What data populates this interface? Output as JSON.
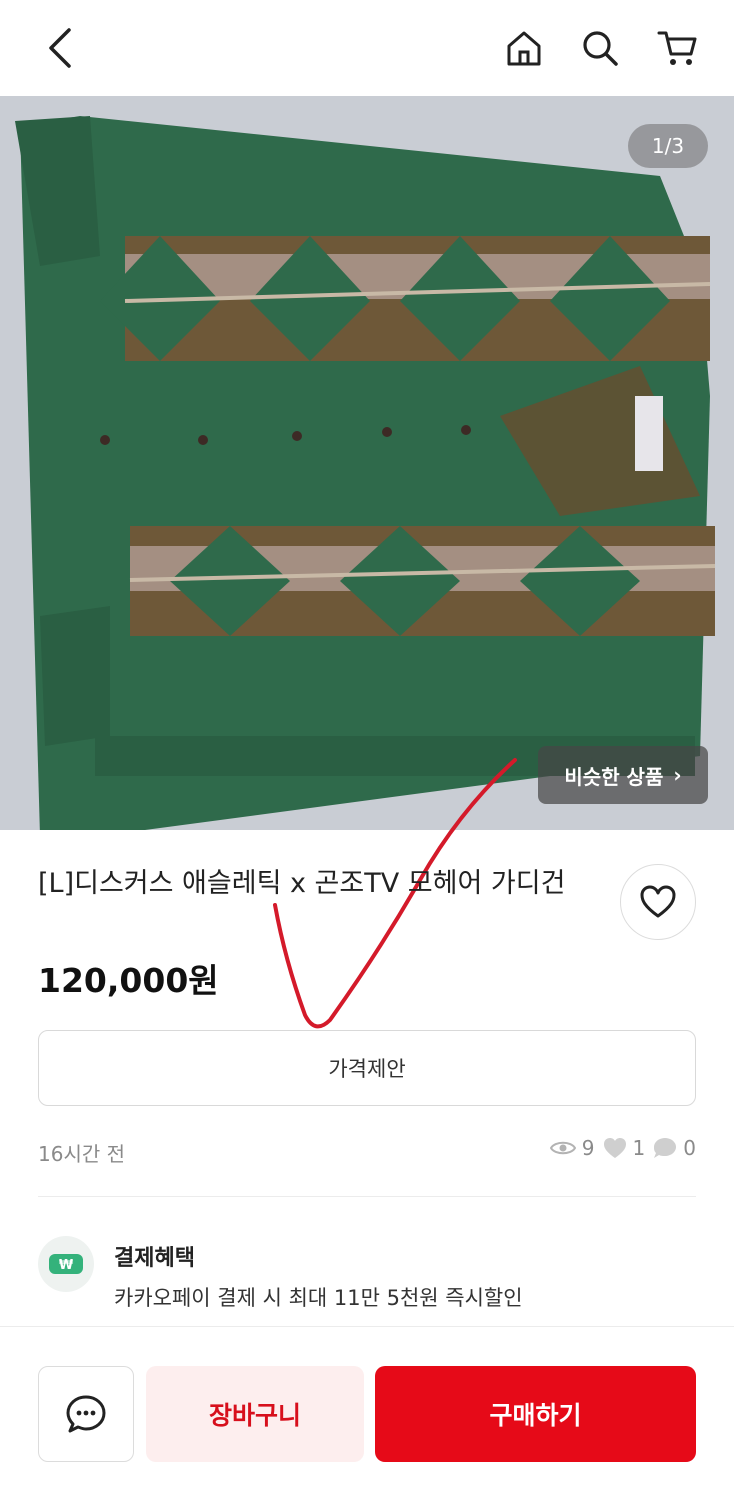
{
  "header": {
    "icons": [
      "back-arrow-icon",
      "home-icon",
      "search-icon",
      "cart-icon"
    ]
  },
  "gallery": {
    "counter": "1/3",
    "similar_label": "비슷한 상품",
    "similar_chevron": "›"
  },
  "product": {
    "title": "[L]디스커스 애슬레틱 x 곤조TV 모헤어 가디건",
    "price": "120,000원",
    "offer_label": "가격제안",
    "posted_time": "16시간 전",
    "stats": {
      "views": "9",
      "likes": "1",
      "chats": "0"
    }
  },
  "benefit": {
    "title": "결제혜택",
    "description": "카카오페이 결제 시 최대 11만 5천원 즉시할인",
    "icon_symbol": "₩"
  },
  "bottom_bar": {
    "cart_label": "장바구니",
    "buy_label": "구매하기"
  },
  "colors": {
    "accent_red": "#e60a18",
    "cart_bg": "#fdeeee",
    "sweater_green": "#2e6b4a"
  }
}
